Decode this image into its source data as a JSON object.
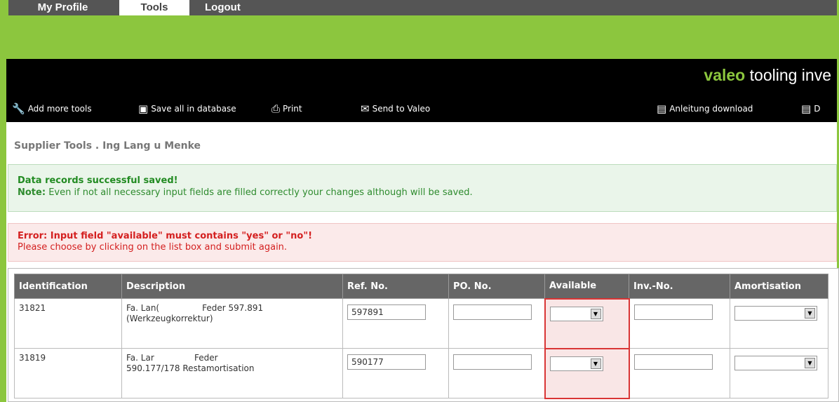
{
  "nav": {
    "tabs": [
      {
        "label": "My Profile"
      },
      {
        "label": "Tools"
      },
      {
        "label": "Logout"
      }
    ]
  },
  "brand": {
    "logo": "valeo",
    "tagline": "tooling inve"
  },
  "toolbar": {
    "add_label": "Add more tools",
    "save_label": "Save all in database",
    "print_label": "Print",
    "send_label": "Send to Valeo",
    "anleitung_label": "Anleitung download",
    "d_label": "D"
  },
  "page": {
    "supplier_title": "Supplier Tools . Ing Lang u Menke"
  },
  "messages": {
    "success_title": "Data records successful saved!",
    "success_note_label": "Note:",
    "success_note": "Even if not all necessary input fields are filled correctly your changes although will be saved.",
    "error_title": "Error: Input field \"available\" must contains \"yes\" or \"no\"!",
    "error_text": "Please choose by clicking on the list box and submit again."
  },
  "table": {
    "headers": [
      "Identification",
      "Description",
      "Ref. No.",
      "PO. No.",
      "Available",
      "Inv.-No.",
      "Amortisation"
    ],
    "rows": [
      {
        "id": "31821",
        "desc_line1": "Fa. Lan(                Feder 597.891",
        "desc_line2": "(Werkzeugkorrektur)",
        "ref": "597891",
        "po": "",
        "available": "",
        "inv": "",
        "amort": ""
      },
      {
        "id": "31819",
        "desc_line1": "Fa. Lar               Feder",
        "desc_line2": "590.177/178 Restamortisation",
        "ref": "590177",
        "po": "",
        "available": "",
        "inv": "",
        "amort": ""
      }
    ]
  },
  "colors": {
    "accent_green": "#8cc63e",
    "header_black": "#000000",
    "error_red": "#d42020",
    "success_green": "#228b22"
  },
  "icons": [
    "wrench-icon",
    "floppy-disk-icon",
    "printer-icon",
    "envelope-icon",
    "pdf-document-icon",
    "select-arrow-icon"
  ]
}
